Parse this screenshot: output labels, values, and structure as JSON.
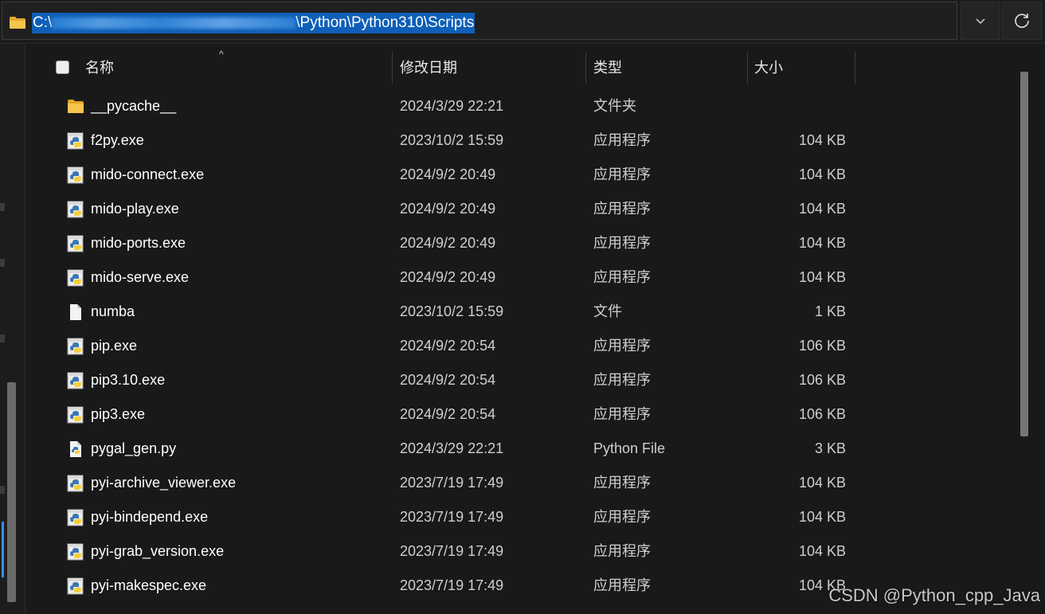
{
  "address_bar": {
    "path_prefix": "C:\\",
    "path_suffix": "\\Python\\Python310\\Scripts"
  },
  "columns": {
    "name": "名称",
    "date": "修改日期",
    "type": "类型",
    "size": "大小"
  },
  "files": [
    {
      "name": "__pycache__",
      "date": "2024/3/29 22:21",
      "type": "文件夹",
      "size": "",
      "icon": "folder-icon"
    },
    {
      "name": "f2py.exe",
      "date": "2023/10/2 15:59",
      "type": "应用程序",
      "size": "104 KB",
      "icon": "python-exe-icon"
    },
    {
      "name": "mido-connect.exe",
      "date": "2024/9/2 20:49",
      "type": "应用程序",
      "size": "104 KB",
      "icon": "python-exe-icon"
    },
    {
      "name": "mido-play.exe",
      "date": "2024/9/2 20:49",
      "type": "应用程序",
      "size": "104 KB",
      "icon": "python-exe-icon"
    },
    {
      "name": "mido-ports.exe",
      "date": "2024/9/2 20:49",
      "type": "应用程序",
      "size": "104 KB",
      "icon": "python-exe-icon"
    },
    {
      "name": "mido-serve.exe",
      "date": "2024/9/2 20:49",
      "type": "应用程序",
      "size": "104 KB",
      "icon": "python-exe-icon"
    },
    {
      "name": "numba",
      "date": "2023/10/2 15:59",
      "type": "文件",
      "size": "1 KB",
      "icon": "file-icon"
    },
    {
      "name": "pip.exe",
      "date": "2024/9/2 20:54",
      "type": "应用程序",
      "size": "106 KB",
      "icon": "python-exe-icon"
    },
    {
      "name": "pip3.10.exe",
      "date": "2024/9/2 20:54",
      "type": "应用程序",
      "size": "106 KB",
      "icon": "python-exe-icon"
    },
    {
      "name": "pip3.exe",
      "date": "2024/9/2 20:54",
      "type": "应用程序",
      "size": "106 KB",
      "icon": "python-exe-icon"
    },
    {
      "name": "pygal_gen.py",
      "date": "2024/3/29 22:21",
      "type": "Python File",
      "size": "3 KB",
      "icon": "python-file-icon"
    },
    {
      "name": "pyi-archive_viewer.exe",
      "date": "2023/7/19 17:49",
      "type": "应用程序",
      "size": "104 KB",
      "icon": "python-exe-icon"
    },
    {
      "name": "pyi-bindepend.exe",
      "date": "2023/7/19 17:49",
      "type": "应用程序",
      "size": "104 KB",
      "icon": "python-exe-icon"
    },
    {
      "name": "pyi-grab_version.exe",
      "date": "2023/7/19 17:49",
      "type": "应用程序",
      "size": "104 KB",
      "icon": "python-exe-icon"
    },
    {
      "name": "pyi-makespec.exe",
      "date": "2023/7/19 17:49",
      "type": "应用程序",
      "size": "104 KB",
      "icon": "python-exe-icon"
    }
  ],
  "watermark": "CSDN @Python_cpp_Java",
  "colors": {
    "background": "#191919",
    "selection": "#0f5fb8",
    "folder": "#f2c14e",
    "python_blue": "#3a77b5",
    "python_yellow": "#f5cf3c"
  }
}
